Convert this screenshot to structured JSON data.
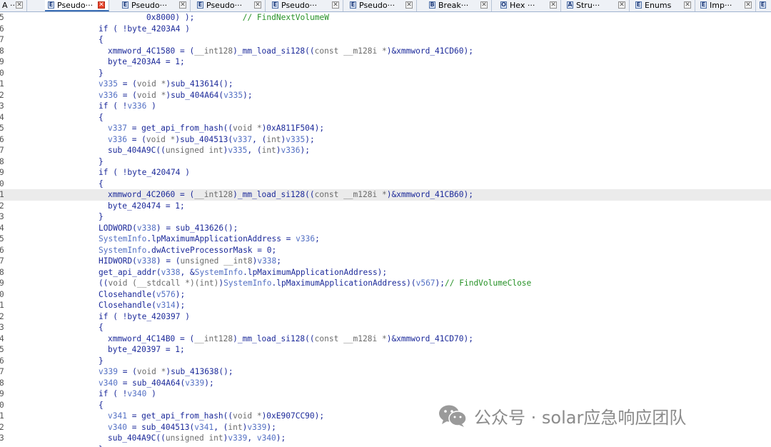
{
  "tabs": [
    {
      "label": "A ···",
      "icon": "",
      "close": "✕"
    },
    {
      "label": "Pseudo···",
      "icon": "E",
      "close": "✕",
      "active": true
    },
    {
      "label": "Pseudo···",
      "icon": "E",
      "close": "✕"
    },
    {
      "label": "Pseudo···",
      "icon": "E",
      "close": "✕"
    },
    {
      "label": "Pseudo···",
      "icon": "E",
      "close": "✕"
    },
    {
      "label": "Pseudo···",
      "icon": "E",
      "close": "✕"
    },
    {
      "label": "Break···",
      "icon": "B",
      "close": "✕"
    },
    {
      "label": "Hex ···",
      "icon": "O",
      "close": "✕"
    },
    {
      "label": "Stru···",
      "icon": "A",
      "close": "✕"
    },
    {
      "label": "Enums",
      "icon": "E",
      "close": "✕"
    },
    {
      "label": "Imp···",
      "icon": "E",
      "close": "✕"
    },
    {
      "label": "",
      "icon": "E",
      "close": ""
    }
  ],
  "code_lines": [
    {
      "n": "5",
      "i": 26,
      "t": [
        [
          "p",
          "0x8000) );          "
        ],
        [
          "c",
          "// FindNextVolumeW"
        ]
      ]
    },
    {
      "n": "6",
      "i": 16,
      "t": [
        [
          "p",
          "if ( !byte_4203A4 )"
        ]
      ]
    },
    {
      "n": "7",
      "i": 16,
      "t": [
        [
          "p",
          "{"
        ]
      ]
    },
    {
      "n": "8",
      "i": 18,
      "t": [
        [
          "p",
          "xmmword_4C1580 = ("
        ],
        [
          "k",
          "__int128"
        ],
        [
          "p",
          ")_mm_load_si128(("
        ],
        [
          "k",
          "const __m128i *"
        ],
        [
          "p",
          ")&xmmword_41CD60);"
        ]
      ]
    },
    {
      "n": "9",
      "i": 18,
      "t": [
        [
          "p",
          "byte_4203A4 = 1;"
        ]
      ]
    },
    {
      "n": "0",
      "i": 16,
      "t": [
        [
          "p",
          "}"
        ]
      ]
    },
    {
      "n": "1",
      "i": 16,
      "t": [
        [
          "v",
          "v335"
        ],
        [
          "p",
          " = ("
        ],
        [
          "k",
          "void *"
        ],
        [
          "p",
          ")sub_413614();"
        ]
      ]
    },
    {
      "n": "2",
      "i": 16,
      "t": [
        [
          "v",
          "v336"
        ],
        [
          "p",
          " = ("
        ],
        [
          "k",
          "void *"
        ],
        [
          "p",
          ")sub_404A64("
        ],
        [
          "v",
          "v335"
        ],
        [
          "p",
          ");"
        ]
      ]
    },
    {
      "n": "3",
      "i": 16,
      "t": [
        [
          "p",
          "if ( !"
        ],
        [
          "v",
          "v336"
        ],
        [
          "p",
          " )"
        ]
      ]
    },
    {
      "n": "4",
      "i": 16,
      "t": [
        [
          "p",
          "{"
        ]
      ]
    },
    {
      "n": "5",
      "i": 18,
      "t": [
        [
          "v",
          "v337"
        ],
        [
          "p",
          " = get_api_from_hash(("
        ],
        [
          "k",
          "void *"
        ],
        [
          "p",
          ")0xA811F504);"
        ]
      ]
    },
    {
      "n": "6",
      "i": 18,
      "t": [
        [
          "v",
          "v336"
        ],
        [
          "p",
          " = ("
        ],
        [
          "k",
          "void *"
        ],
        [
          "p",
          ")sub_404513("
        ],
        [
          "v",
          "v337"
        ],
        [
          "p",
          ", ("
        ],
        [
          "k",
          "int"
        ],
        [
          "p",
          ")"
        ],
        [
          "v",
          "v335"
        ],
        [
          "p",
          ");"
        ]
      ]
    },
    {
      "n": "7",
      "i": 18,
      "t": [
        [
          "p",
          "sub_404A9C(("
        ],
        [
          "k",
          "unsigned int"
        ],
        [
          "p",
          ")"
        ],
        [
          "v",
          "v335"
        ],
        [
          "p",
          ", ("
        ],
        [
          "k",
          "int"
        ],
        [
          "p",
          ")"
        ],
        [
          "v",
          "v336"
        ],
        [
          "p",
          ");"
        ]
      ]
    },
    {
      "n": "8",
      "i": 16,
      "t": [
        [
          "p",
          "}"
        ]
      ]
    },
    {
      "n": "9",
      "i": 16,
      "t": [
        [
          "p",
          "if ( !byte_420474 )"
        ]
      ]
    },
    {
      "n": "0",
      "i": 16,
      "t": [
        [
          "p",
          "{"
        ]
      ]
    },
    {
      "n": "1",
      "i": 18,
      "hl": true,
      "t": [
        [
          "p",
          "xmmword_4C2060 = ("
        ],
        [
          "k",
          "__int128"
        ],
        [
          "p",
          ")_mm_load_si128(("
        ],
        [
          "k",
          "const __m128i *"
        ],
        [
          "p",
          ")&xmmword_41CB60);"
        ]
      ]
    },
    {
      "n": "2",
      "i": 18,
      "t": [
        [
          "p",
          "byte_420474 = 1;"
        ]
      ]
    },
    {
      "n": "3",
      "i": 16,
      "t": [
        [
          "p",
          "}"
        ]
      ]
    },
    {
      "n": "4",
      "i": 16,
      "t": [
        [
          "p",
          "LODWORD("
        ],
        [
          "v",
          "v338"
        ],
        [
          "p",
          ") = sub_413626();"
        ]
      ]
    },
    {
      "n": "5",
      "i": 16,
      "t": [
        [
          "v",
          "SystemInfo"
        ],
        [
          "p",
          ".lpMaximumApplicationAddress = "
        ],
        [
          "v",
          "v336"
        ],
        [
          "p",
          ";"
        ]
      ]
    },
    {
      "n": "6",
      "i": 16,
      "t": [
        [
          "v",
          "SystemInfo"
        ],
        [
          "p",
          ".dwActiveProcessorMask = 0;"
        ]
      ]
    },
    {
      "n": "7",
      "i": 16,
      "t": [
        [
          "p",
          "HIDWORD("
        ],
        [
          "v",
          "v338"
        ],
        [
          "p",
          ") = ("
        ],
        [
          "k",
          "unsigned __int8"
        ],
        [
          "p",
          ")"
        ],
        [
          "v",
          "v338"
        ],
        [
          "p",
          ";"
        ]
      ]
    },
    {
      "n": "8",
      "i": 16,
      "t": [
        [
          "p",
          "get_api_addr("
        ],
        [
          "v",
          "v338"
        ],
        [
          "p",
          ", &"
        ],
        [
          "v",
          "SystemInfo"
        ],
        [
          "p",
          ".lpMaximumApplicationAddress);"
        ]
      ]
    },
    {
      "n": "9",
      "i": 16,
      "t": [
        [
          "p",
          "(("
        ],
        [
          "k",
          "void (__stdcall *)(int)"
        ],
        [
          "p",
          ")"
        ],
        [
          "v",
          "SystemInfo"
        ],
        [
          "p",
          ".lpMaximumApplicationAddress)("
        ],
        [
          "v",
          "v567"
        ],
        [
          "p",
          ");"
        ],
        [
          "c",
          "// FindVolumeClose"
        ]
      ]
    },
    {
      "n": "0",
      "i": 16,
      "t": [
        [
          "p",
          "Closehandle("
        ],
        [
          "v",
          "v576"
        ],
        [
          "p",
          ");"
        ]
      ]
    },
    {
      "n": "1",
      "i": 16,
      "t": [
        [
          "p",
          "Closehandle("
        ],
        [
          "v",
          "v314"
        ],
        [
          "p",
          ");"
        ]
      ]
    },
    {
      "n": "2",
      "i": 16,
      "t": [
        [
          "p",
          "if ( !byte_420397 )"
        ]
      ]
    },
    {
      "n": "3",
      "i": 16,
      "t": [
        [
          "p",
          "{"
        ]
      ]
    },
    {
      "n": "4",
      "i": 18,
      "t": [
        [
          "p",
          "xmmword_4C14B0 = ("
        ],
        [
          "k",
          "__int128"
        ],
        [
          "p",
          ")_mm_load_si128(("
        ],
        [
          "k",
          "const __m128i *"
        ],
        [
          "p",
          ")&xmmword_41CD70);"
        ]
      ]
    },
    {
      "n": "5",
      "i": 18,
      "t": [
        [
          "p",
          "byte_420397 = 1;"
        ]
      ]
    },
    {
      "n": "6",
      "i": 16,
      "t": [
        [
          "p",
          "}"
        ]
      ]
    },
    {
      "n": "7",
      "i": 16,
      "t": [
        [
          "v",
          "v339"
        ],
        [
          "p",
          " = ("
        ],
        [
          "k",
          "void *"
        ],
        [
          "p",
          ")sub_413638();"
        ]
      ]
    },
    {
      "n": "8",
      "i": 16,
      "t": [
        [
          "v",
          "v340"
        ],
        [
          "p",
          " = sub_404A64("
        ],
        [
          "v",
          "v339"
        ],
        [
          "p",
          ");"
        ]
      ]
    },
    {
      "n": "9",
      "i": 16,
      "t": [
        [
          "p",
          "if ( !"
        ],
        [
          "v",
          "v340"
        ],
        [
          "p",
          " )"
        ]
      ]
    },
    {
      "n": "0",
      "i": 16,
      "t": [
        [
          "p",
          "{"
        ]
      ]
    },
    {
      "n": "1",
      "i": 18,
      "t": [
        [
          "v",
          "v341"
        ],
        [
          "p",
          " = get_api_from_hash(("
        ],
        [
          "k",
          "void *"
        ],
        [
          "p",
          ")0xE907CC90);"
        ]
      ]
    },
    {
      "n": "2",
      "i": 18,
      "t": [
        [
          "v",
          "v340"
        ],
        [
          "p",
          " = sub_404513("
        ],
        [
          "v",
          "v341"
        ],
        [
          "p",
          ", ("
        ],
        [
          "k",
          "int"
        ],
        [
          "p",
          ")"
        ],
        [
          "v",
          "v339"
        ],
        [
          "p",
          ");"
        ]
      ]
    },
    {
      "n": "3",
      "i": 18,
      "t": [
        [
          "p",
          "sub_404A9C(("
        ],
        [
          "k",
          "unsigned int"
        ],
        [
          "p",
          ")"
        ],
        [
          "v",
          "v339"
        ],
        [
          "p",
          ", "
        ],
        [
          "v",
          "v340"
        ],
        [
          "p",
          ");"
        ]
      ]
    },
    {
      "n": "",
      "i": 16,
      "t": [
        [
          "p",
          "}"
        ]
      ]
    }
  ],
  "watermark": {
    "text": "公众号 · solar应急响应团队",
    "logo_icon": "wechat-icon"
  },
  "colors": {
    "plain": "#1c2a9a",
    "variable": "#5370c4",
    "comment": "#279227",
    "keyword": "#6c6c6c",
    "highlight": "#ebebeb"
  }
}
